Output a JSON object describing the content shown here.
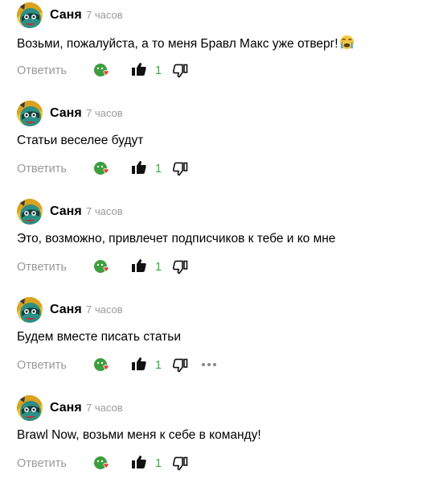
{
  "colors": {
    "author": "#000000",
    "time": "#9a9a9a",
    "reply": "#999999",
    "like_count": "#37a937",
    "reaction_green": "#3c9e3c",
    "reaction_heart": "#e6382f"
  },
  "icons": {
    "avatar": "brawl-character-avatar",
    "reaction": "reaction-heart-icon",
    "like": "thumb-up-icon",
    "dislike": "thumb-down-icon",
    "more": "more-dots-icon",
    "emoji": "crying-emoji"
  },
  "comments": [
    {
      "author": "Саня",
      "time": "7 часов",
      "text": "Возьми, пожалуйста, а то меня Бравл Макс уже отверг!",
      "reply_label": "Ответить",
      "likes": "1"
    },
    {
      "author": "Саня",
      "time": "7 часов",
      "text": "Статьи веселее будут",
      "reply_label": "Ответить",
      "likes": "1"
    },
    {
      "author": "Саня",
      "time": "7 часов",
      "text": "Это, возможно, привлечет подписчиков к тебе и ко мне",
      "reply_label": "Ответить",
      "likes": "1"
    },
    {
      "author": "Саня",
      "time": "7 часов",
      "text": "Будем вместе писать статьи",
      "reply_label": "Ответить",
      "likes": "1"
    },
    {
      "author": "Саня",
      "time": "7 часов",
      "text": "Brawl Now, возьми меня к себе в команду!",
      "reply_label": "Ответить",
      "likes": "1"
    }
  ]
}
